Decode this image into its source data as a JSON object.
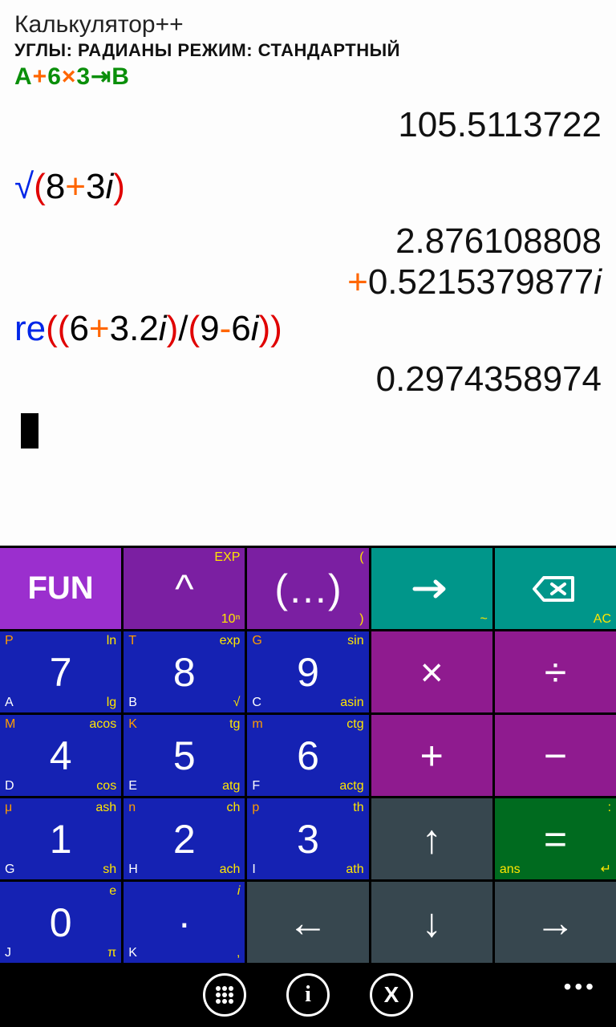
{
  "header": {
    "title": "Калькулятор++",
    "mode_line": "УГЛЫ: РАДИАНЫ  РЕЖИМ: СТАНДАРТНЫЙ",
    "hint_A": "A",
    "hint_plus": "+",
    "hint_6": "6",
    "hint_x": "×",
    "hint_3": "3",
    "hint_arrow": "⇥",
    "hint_B": "B"
  },
  "history": {
    "r1": "105.5113722",
    "l2_fn": "√",
    "l2_p1": "(",
    "l2_n1": "8",
    "l2_op": "+",
    "l2_n2": "3",
    "l2_i": "i",
    "l2_p2": ")",
    "r3": "2.876108808",
    "r4_op": "+",
    "r4_n": "0.5215379877",
    "r4_i": "i",
    "l5_fn": "re",
    "l5_p1": "((",
    "l5_n1": "6",
    "l5_op1": "+",
    "l5_n2": "3.2",
    "l5_i1": "i",
    "l5_p2": ")",
    "l5_div": "/",
    "l5_p3": "(",
    "l5_n3": "9",
    "l5_op2": "-",
    "l5_n4": "6",
    "l5_i2": "i",
    "l5_p4": "))",
    "r6": "0.2974358974"
  },
  "keys": {
    "fun": "FUN",
    "pow": "^",
    "pow_tr": "EXP",
    "pow_br": "10ⁿ",
    "paren": "(…)",
    "paren_tr": "(",
    "paren_br": ")",
    "arrow_br": "~",
    "bksp_br": "AC",
    "d7": "7",
    "d7_tl": "P",
    "d7_tr": "ln",
    "d7_bl": "A",
    "d7_br": "lg",
    "d8": "8",
    "d8_tl": "T",
    "d8_tr": "exp",
    "d8_bl": "B",
    "d8_br": "√",
    "d9": "9",
    "d9_tl": "G",
    "d9_tr": "sin",
    "d9_bl": "C",
    "d9_br": "asin",
    "mul": "×",
    "div": "÷",
    "d4": "4",
    "d4_tl": "M",
    "d4_tr": "acos",
    "d4_bl": "D",
    "d4_br": "cos",
    "d5": "5",
    "d5_tl": "K",
    "d5_tr": "tg",
    "d5_bl": "E",
    "d5_br": "atg",
    "d6": "6",
    "d6_tl": "m",
    "d6_tr": "ctg",
    "d6_bl": "F",
    "d6_br": "actg",
    "add": "+",
    "sub": "−",
    "d1": "1",
    "d1_tl": "μ",
    "d1_tr": "ash",
    "d1_bl": "G",
    "d1_br": "sh",
    "d2": "2",
    "d2_tl": "n",
    "d2_tr": "ch",
    "d2_bl": "H",
    "d2_br": "ach",
    "d3": "3",
    "d3_tl": "p",
    "d3_tr": "th",
    "d3_bl": "I",
    "d3_br": "ath",
    "up": "↑",
    "eq": "=",
    "eq_tr": ":",
    "eq_bl": "ans",
    "eq_br": "↵",
    "d0": "0",
    "d0_tr": "e",
    "d0_bl": "J",
    "d0_br": "π",
    "dot": "·",
    "dot_tr": "i",
    "dot_bl": "K",
    "dot_br": ",",
    "left": "←",
    "down": "↓",
    "right": "→"
  },
  "bottombar": {
    "more": "•••"
  }
}
